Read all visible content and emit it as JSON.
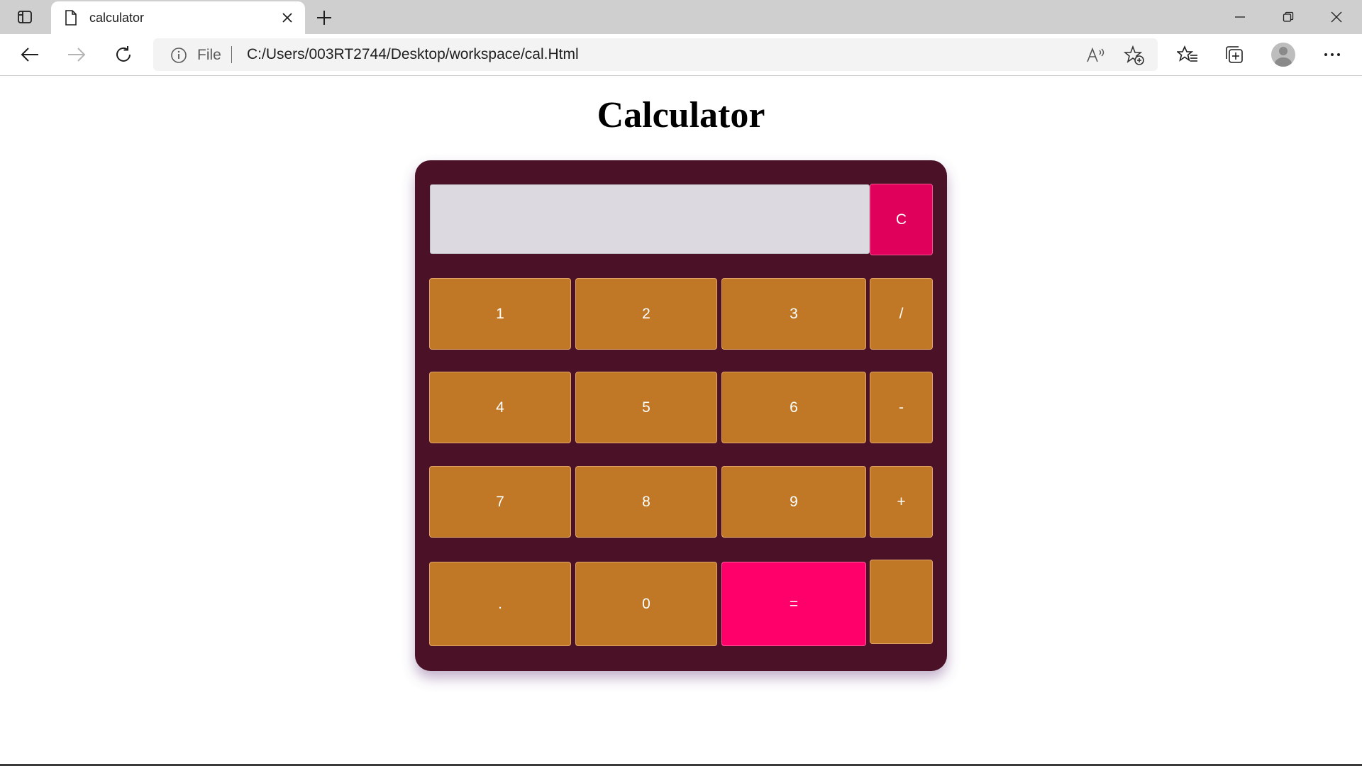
{
  "browser": {
    "tab_title": "calculator",
    "address_scheme": "File",
    "url": "C:/Users/003RT2744/Desktop/workspace/cal.Html"
  },
  "page": {
    "title": "Calculator"
  },
  "calculator": {
    "display_value": "",
    "clear_label": "C",
    "keys": {
      "k1": "1",
      "k2": "2",
      "k3": "3",
      "div": "/",
      "k4": "4",
      "k5": "5",
      "k6": "6",
      "minus": "-",
      "k7": "7",
      "k8": "8",
      "k9": "9",
      "plus": "+",
      "dot": ".",
      "k0": "0",
      "equals": "=",
      "blank": ""
    }
  },
  "colors": {
    "calculator_bg": "#4a1127",
    "key_bg": "#c17826",
    "clear_bg": "#e0005c",
    "equals_bg": "#ff006a",
    "display_bg": "#dcdae0"
  }
}
